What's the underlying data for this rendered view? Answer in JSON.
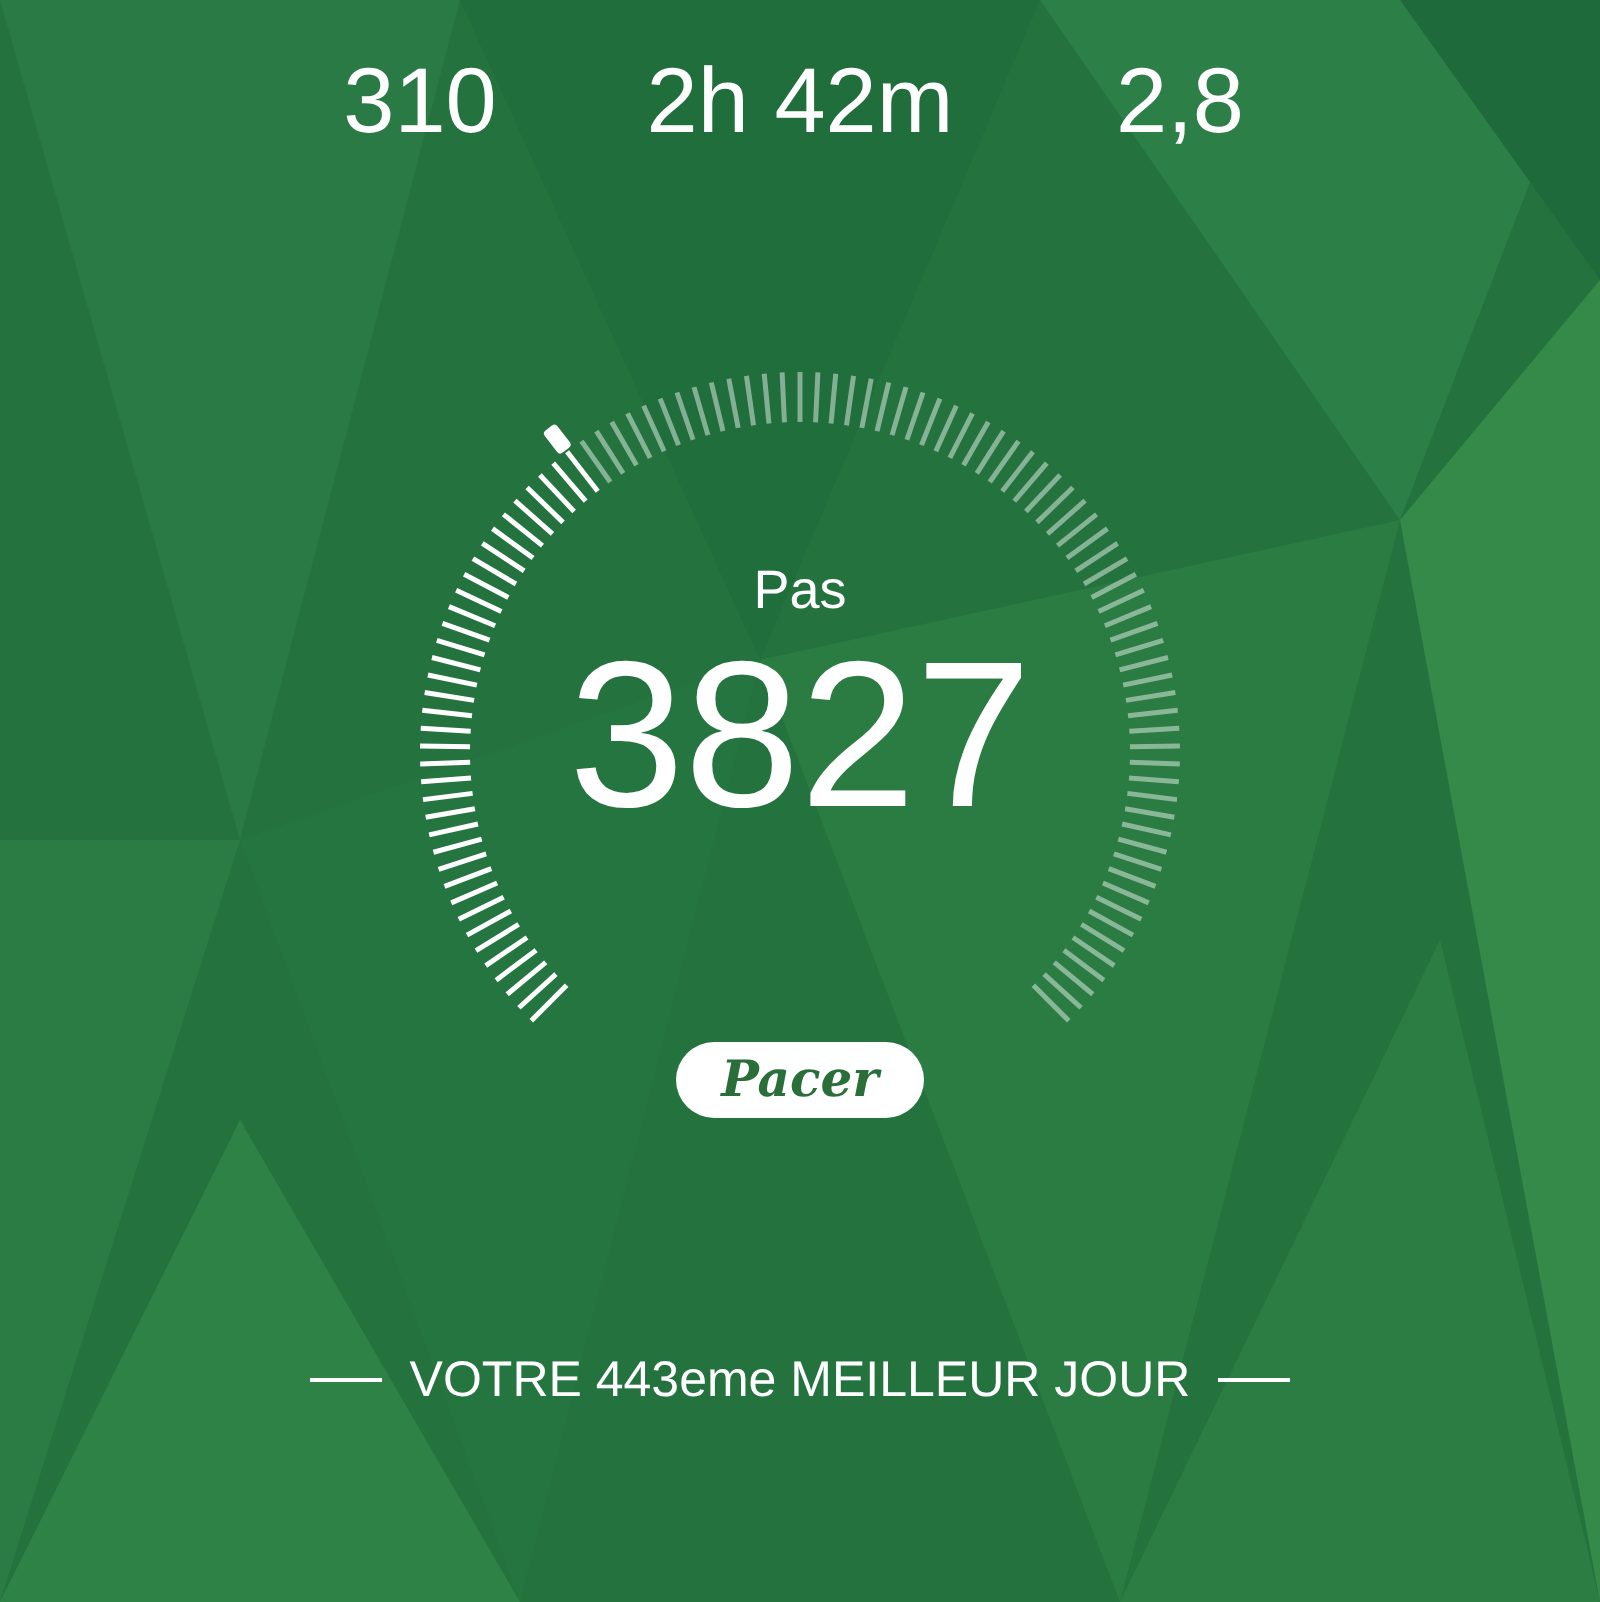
{
  "stats": [
    {
      "value": "310"
    },
    {
      "value": "2h 42m"
    },
    {
      "value": "2,8"
    }
  ],
  "gauge": {
    "label": "Pas",
    "value": "3827"
  },
  "badge": {
    "label": "Pacer"
  },
  "footer": {
    "text": "VOTRE 443eme MEILLEUR JOUR"
  }
}
